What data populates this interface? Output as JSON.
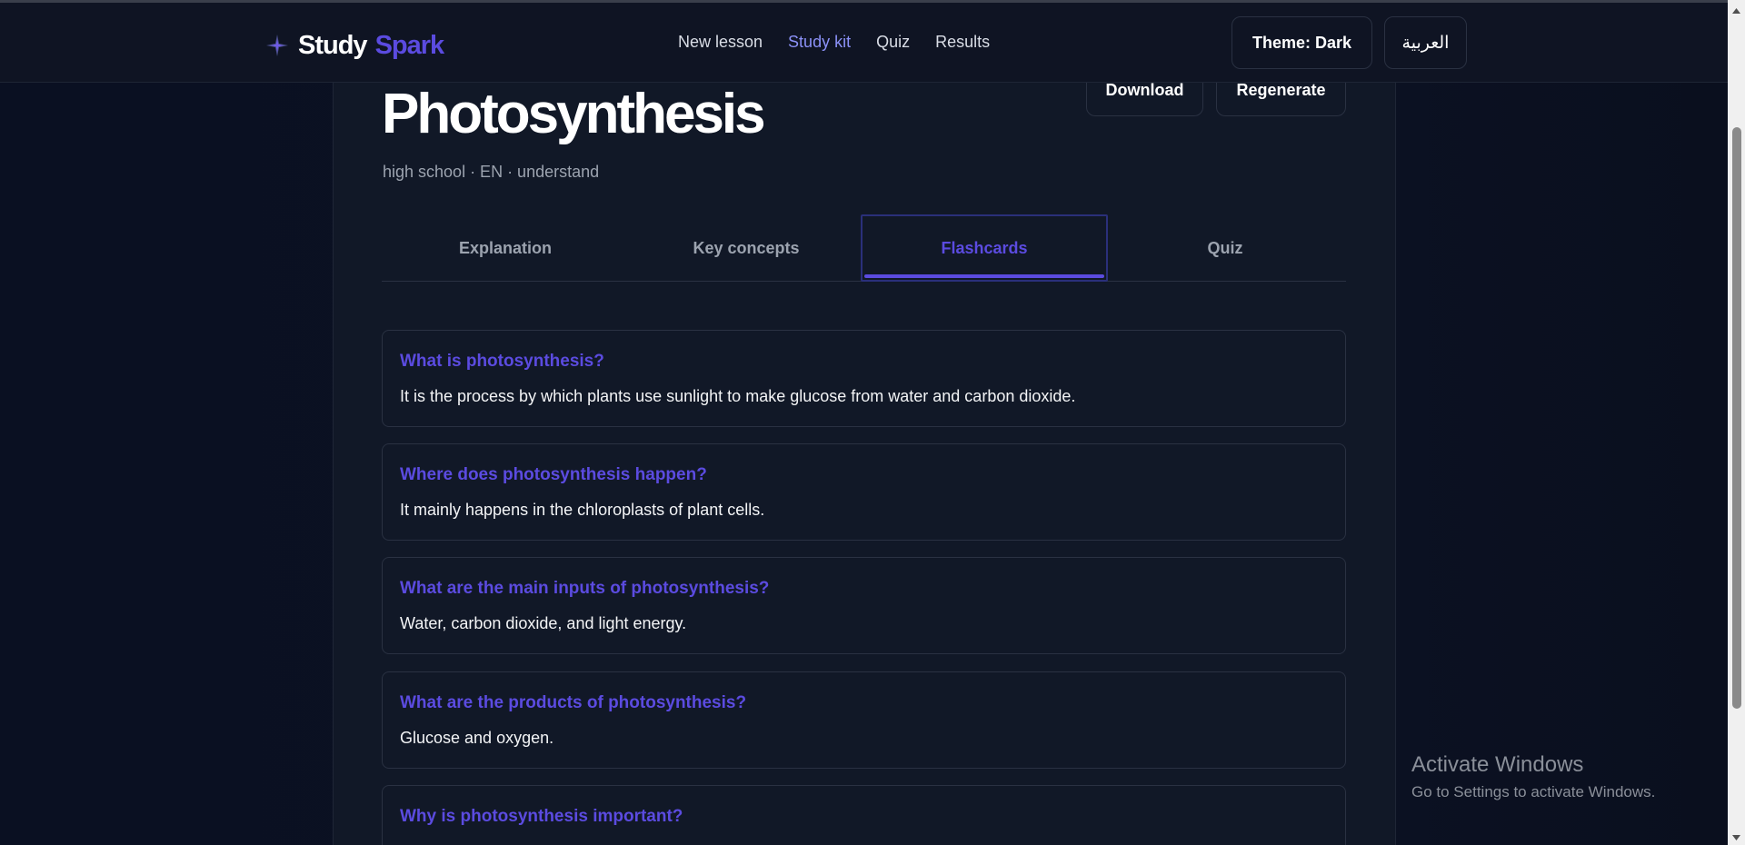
{
  "header": {
    "brand_word1": "Study",
    "brand_word2": "Spark",
    "nav": [
      {
        "label": "New lesson"
      },
      {
        "label": "Study kit"
      },
      {
        "label": "Quiz"
      },
      {
        "label": "Results"
      }
    ],
    "theme_button": "Theme: Dark",
    "language_button": "العربية"
  },
  "lesson": {
    "title": "Photosynthesis",
    "meta": "high school · EN · understand",
    "download_label": "Download",
    "regenerate_label": "Regenerate"
  },
  "tabs": [
    {
      "label": "Explanation"
    },
    {
      "label": "Key concepts"
    },
    {
      "label": "Flashcards"
    },
    {
      "label": "Quiz"
    }
  ],
  "active_tab": "Flashcards",
  "flashcards": [
    {
      "question": "What is photosynthesis?",
      "answer": "It is the process by which plants use sunlight to make glucose from water and carbon dioxide."
    },
    {
      "question": "Where does photosynthesis happen?",
      "answer": "It mainly happens in the chloroplasts of plant cells."
    },
    {
      "question": "What are the main inputs of photosynthesis?",
      "answer": "Water, carbon dioxide, and light energy."
    },
    {
      "question": "What are the products of photosynthesis?",
      "answer": "Glucose and oxygen."
    },
    {
      "question": "Why is photosynthesis important?",
      "answer": ""
    }
  ],
  "watermark": {
    "line1": "Activate Windows",
    "line2": "Go to Settings to activate Windows."
  },
  "colors": {
    "accent": "#5b4be0",
    "nav_active": "#8b91f7",
    "background": "#0b1020",
    "card": "#111827"
  },
  "icons": {
    "brand": "sparkle-icon",
    "scroll_up": "chevron-up-icon",
    "scroll_down": "chevron-down-icon"
  }
}
